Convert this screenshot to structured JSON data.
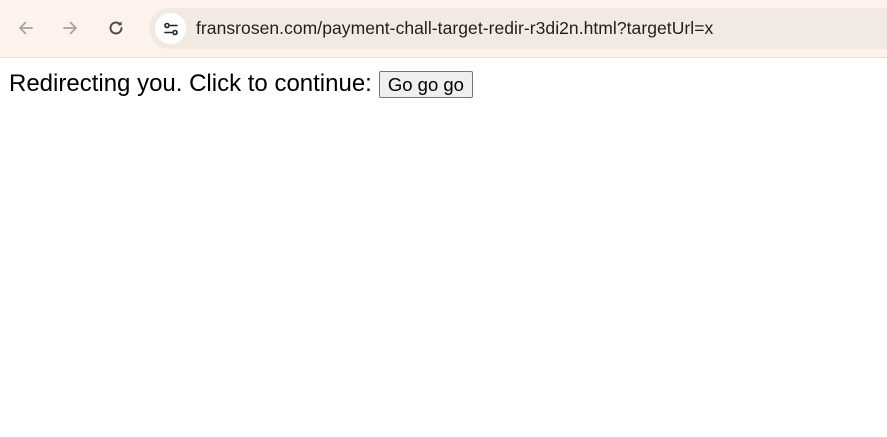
{
  "browser": {
    "back_icon": "arrow-left-icon",
    "forward_icon": "arrow-right-icon",
    "reload_icon": "reload-icon",
    "site_info_icon": "tune-icon",
    "url": "fransrosen.com/payment-chall-target-redir-r3di2n.html?targetUrl=x"
  },
  "page": {
    "message": "Redirecting you. Click to continue:",
    "button_label": "Go go go"
  }
}
